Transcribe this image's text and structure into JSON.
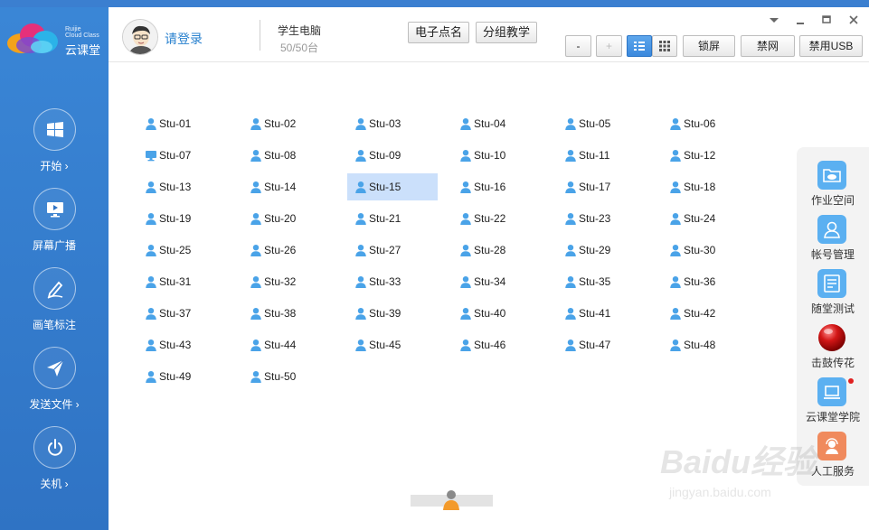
{
  "sidebar": {
    "brand_en": "Ruijie\nCloud Class",
    "brand_cn": "云课堂",
    "items": [
      {
        "label": "开始 ›"
      },
      {
        "label": "屏幕广播"
      },
      {
        "label": "画笔标注"
      },
      {
        "label": "发送文件 ›"
      },
      {
        "label": "关机 ›"
      }
    ]
  },
  "header": {
    "login": "请登录",
    "pc_title": "学生电脑",
    "pc_count": "50/50台",
    "rollcall": "电子点名",
    "group_teaching": "分组教学",
    "zoom_out": "-",
    "zoom_in": "+",
    "lock_screen": "锁屏",
    "disable_network": "禁网",
    "disable_usb": "禁用USB"
  },
  "students": [
    "Stu-01",
    "Stu-02",
    "Stu-03",
    "Stu-04",
    "Stu-05",
    "Stu-06",
    "Stu-07",
    "Stu-08",
    "Stu-09",
    "Stu-10",
    "Stu-11",
    "Stu-12",
    "Stu-13",
    "Stu-14",
    "Stu-15",
    "Stu-16",
    "Stu-17",
    "Stu-18",
    "Stu-19",
    "Stu-20",
    "Stu-21",
    "Stu-22",
    "Stu-23",
    "Stu-24",
    "Stu-25",
    "Stu-26",
    "Stu-27",
    "Stu-28",
    "Stu-29",
    "Stu-30",
    "Stu-31",
    "Stu-32",
    "Stu-33",
    "Stu-34",
    "Stu-35",
    "Stu-36",
    "Stu-37",
    "Stu-38",
    "Stu-39",
    "Stu-40",
    "Stu-41",
    "Stu-42",
    "Stu-43",
    "Stu-44",
    "Stu-45",
    "Stu-46",
    "Stu-47",
    "Stu-48",
    "Stu-49",
    "Stu-50"
  ],
  "student_status": {
    "selected": "Stu-15",
    "computer_icon": "Stu-07"
  },
  "right_panel": {
    "items": [
      {
        "label": "作业空间"
      },
      {
        "label": "帐号管理"
      },
      {
        "label": "随堂测试"
      },
      {
        "label": "击鼓传花"
      },
      {
        "label": "云课堂学院"
      },
      {
        "label": "人工服务"
      }
    ]
  },
  "watermark": {
    "line1": "Baidu经验",
    "line2": "jingyan.baidu.com"
  },
  "colors": {
    "sidebar": "#3a86d6",
    "accent": "#2a82cf",
    "selected_row": "#cbe0fb",
    "student_icon": "#4aa3e8"
  }
}
